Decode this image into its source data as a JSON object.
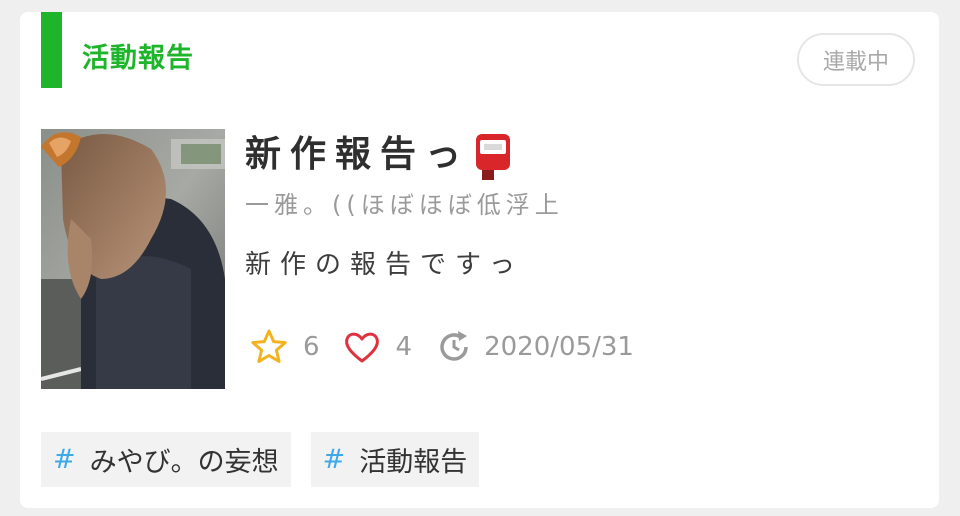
{
  "section": {
    "title": "活動報告",
    "status": "連載中",
    "accent_color": "#1fb52b"
  },
  "work": {
    "title": "新作報告っ",
    "title_emoji": "postbox-icon",
    "author": "一雅。((ほぼほぼ低浮上",
    "description": "新作の報告ですっ",
    "thumbnail": "photo of person in dark hooded coat with fox-ear headband"
  },
  "stats": {
    "stars": "6",
    "likes": "4",
    "updated": "2020/05/31"
  },
  "tags": [
    {
      "hash": "#",
      "label": "みやび。の妄想"
    },
    {
      "hash": "#",
      "label": "活動報告"
    }
  ],
  "colors": {
    "tag_hash": "#3fa9e8",
    "star": "#f3b321",
    "heart": "#e0313f"
  }
}
